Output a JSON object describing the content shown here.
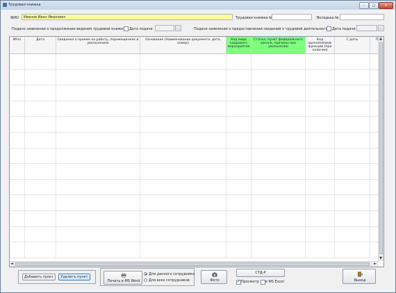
{
  "window": {
    "title": "Трудовая книжка",
    "controls": {
      "minimize": "–",
      "maximize": "□",
      "close": "x"
    }
  },
  "form": {
    "fio_label": "ФИО",
    "fio_value": "Иванов Иван Иванович",
    "workbook_no_label": "Трудовая книжка №",
    "workbook_no_value": "",
    "insert_no_label": "Вкладыш №",
    "insert_no_value": "",
    "continue_statement_label": "Подано заявление о продолжении ведения трудовой книжки",
    "continue_date_label": "Дата подачи",
    "continue_date_value": ". .",
    "provide_statement_label": "Подано заявление о предоставлении сведений о трудовой деятельности",
    "provide_date_label": "Дата подачи",
    "provide_date_value": "",
    "dots_button": "..."
  },
  "table": {
    "columns": [
      "Nºпп",
      "Дата",
      "Сведения о приеме на работу, перемещениях и увольнениях",
      "Основание (Наименование документа, дата, номер)",
      "Код вида кадрового мероприятия",
      "Статья, пункт федерального закона, причины при увольнении",
      "Код выполняемой функции (при наличии)",
      "С даты",
      "П"
    ],
    "green_columns": [
      4,
      5
    ],
    "row_count": 13
  },
  "scrollbars": {
    "up": "▲",
    "down": "▼",
    "left": "◄",
    "right": "►"
  },
  "bottom": {
    "add_item": "Добавить пункт",
    "delete_item": "Удалить пункт",
    "print_word": "Печать в MS Word",
    "radio_this_employee": "Для данного сотрудника",
    "radio_all_employees": "Для всех сотрудников",
    "photo": "Фото",
    "std_r": "СТД-Р",
    "preview_label": "Просмотр",
    "excel_label": "в MS Excel",
    "exit": "Выход"
  },
  "colors": {
    "fio_field": "#fefe99",
    "green_header": "#7dff7d",
    "titlebar": "#c4d3e6",
    "close_button": "#c8472f"
  },
  "icons": [
    "app-icon",
    "printer-icon",
    "camera-icon",
    "exit-door-icon"
  ]
}
